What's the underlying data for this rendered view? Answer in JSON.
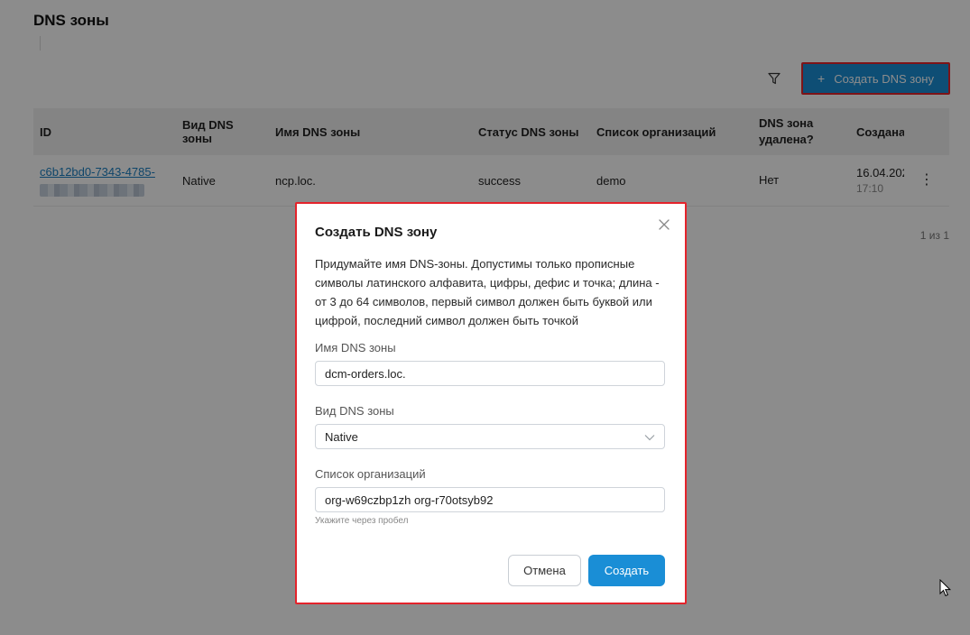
{
  "page": {
    "title": "DNS зоны",
    "create_button_label": "Создать DNS зону",
    "pagination_text": "1 из 1",
    "filter_icon": "filter-icon"
  },
  "table": {
    "columns": [
      "ID",
      "Вид DNS зоны",
      "Имя DNS зоны",
      "Статус DNS зоны",
      "Список организаций",
      "DNS зона удалена?",
      "Создана"
    ],
    "rows": [
      {
        "id": "c6b12bd0-7343-4785-",
        "type": "Native",
        "name": "ncp.loc.",
        "status": "success",
        "orgs": "demo",
        "deleted": "Нет",
        "created_date": "16.04.202",
        "created_time": "17:10"
      }
    ]
  },
  "modal": {
    "title": "Создать DNS зону",
    "description": "Придумайте имя DNS-зоны. Допустимы только прописные символы латинского алфавита, цифры, дефис и точка; длина - от 3 до 64 символов, первый символ должен быть буквой или цифрой, последний символ должен быть точкой",
    "name_label": "Имя DNS зоны",
    "name_value": "dcm-orders.loc.",
    "type_label": "Вид DNS зоны",
    "type_value": "Native",
    "orgs_label": "Список организаций",
    "orgs_value": "org-w69czbp1zh org-r70otsyb92",
    "orgs_hint": "Укажите через пробел",
    "cancel_label": "Отмена",
    "create_label": "Создать"
  },
  "colors": {
    "accent": "#1a8ed6",
    "highlight_border": "#e4232b",
    "overlay": "rgba(0,0,0,0.45)"
  }
}
